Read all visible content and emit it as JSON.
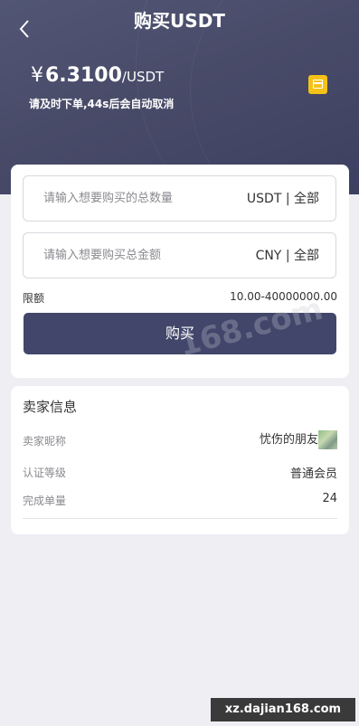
{
  "header": {
    "title": "购买USDT",
    "price_symbol": "¥",
    "price_value": "6.3100",
    "price_unit": "/USDT",
    "hint": "请及时下单,44s后会自动取消",
    "accent_color": "#f5c217"
  },
  "order_form": {
    "quantity_placeholder": "请输入想要购买的总数量",
    "quantity_unit": "USDT",
    "quantity_all": "全部",
    "amount_placeholder": "请输入想要购买总金额",
    "amount_unit": "CNY",
    "amount_all": "全部",
    "separator": "|",
    "limit_label": "限额",
    "limit_value": "10.00-40000000.00",
    "buy_label": "购买"
  },
  "seller": {
    "section_title": "卖家信息",
    "nickname_label": "卖家昵称",
    "nickname_value": "忧伤的朋友",
    "level_label": "认证等级",
    "level_value": "普通会员",
    "orders_label": "完成单量",
    "orders_value": "24"
  },
  "watermark": {
    "text": "168.com",
    "badge": "xz.dajian168.com"
  }
}
